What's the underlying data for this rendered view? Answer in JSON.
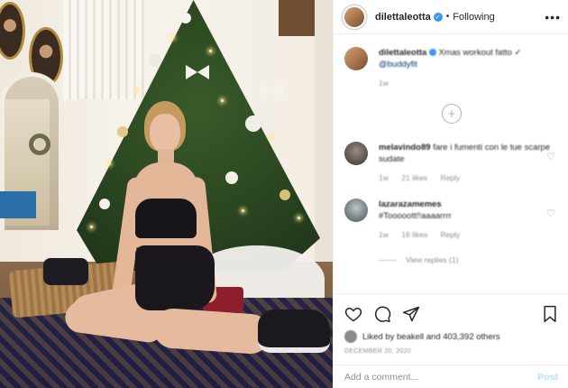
{
  "header": {
    "username": "dilettaleotta",
    "separator": "•",
    "follow_status": "Following",
    "more_label": "•••"
  },
  "caption": {
    "username": "dilettaleotta",
    "text": "Xmas workout fatto ✓",
    "mention": "@buddyfit",
    "time": "1w"
  },
  "load_more_label": "+",
  "comments": [
    {
      "username": "melavindo89",
      "text": "fare i fumenti con le tue scarpe sudate",
      "time": "1w",
      "likes": "21 likes",
      "reply": "Reply",
      "heart": "♡"
    },
    {
      "username": "lazarazamemes",
      "text": "#Tooooott!!aaaarrrr",
      "time": "1w",
      "likes": "16 likes",
      "reply": "Reply",
      "heart": "♡",
      "view_replies": "View replies (1)"
    }
  ],
  "likes_text": "Liked by beakell and 403,392 others",
  "date": "DECEMBER 20, 2020",
  "add_comment": {
    "placeholder": "Add a comment...",
    "post_label": "Post"
  },
  "colors": {
    "verified": "#3897f0",
    "post_button_disabled": "#b2dffc",
    "mention": "#00376b"
  }
}
